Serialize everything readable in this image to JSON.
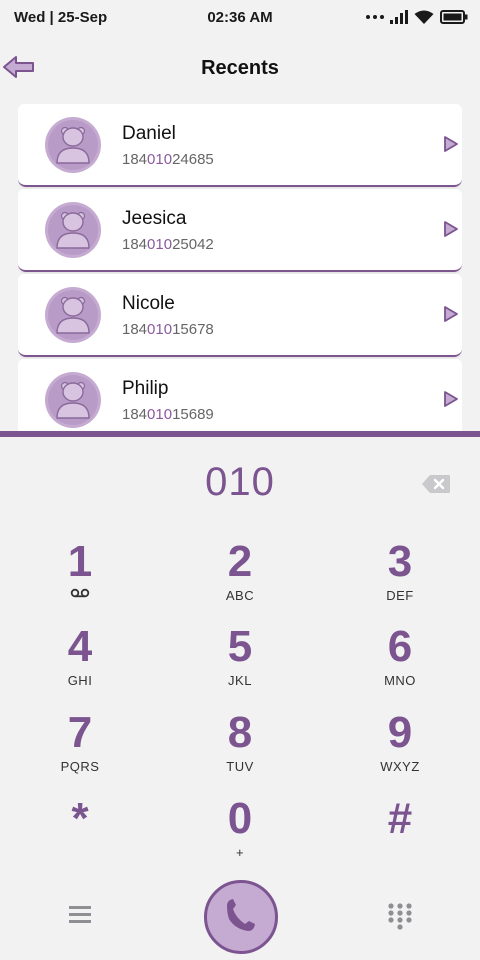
{
  "status_bar": {
    "date": "Wed | 25-Sep",
    "time": "02:36 AM",
    "icons": [
      "dots-icon",
      "signal-icon",
      "wifi-icon",
      "battery-icon"
    ]
  },
  "header": {
    "title": "Recents",
    "back_icon": "back-arrow-icon"
  },
  "recents": [
    {
      "name": "Daniel",
      "number_prefix": "184",
      "number_match": "010",
      "number_suffix": "24685"
    },
    {
      "name": "Jeesica",
      "number_prefix": "184",
      "number_match": "010",
      "number_suffix": "25042"
    },
    {
      "name": "Nicole",
      "number_prefix": "184",
      "number_match": "010",
      "number_suffix": "15678"
    },
    {
      "name": "Philip",
      "number_prefix": "184",
      "number_match": "010",
      "number_suffix": "15689"
    }
  ],
  "dialer": {
    "entered_number": "010",
    "backspace_icon": "backspace-icon"
  },
  "keypad": [
    {
      "digit": "1",
      "letters": "",
      "sub_icon": "voicemail-icon"
    },
    {
      "digit": "2",
      "letters": "ABC"
    },
    {
      "digit": "3",
      "letters": "DEF"
    },
    {
      "digit": "4",
      "letters": "GHI"
    },
    {
      "digit": "5",
      "letters": "JKL"
    },
    {
      "digit": "6",
      "letters": "MNO"
    },
    {
      "digit": "7",
      "letters": "PQRS"
    },
    {
      "digit": "8",
      "letters": "TUV"
    },
    {
      "digit": "9",
      "letters": "WXYZ"
    },
    {
      "digit": "*",
      "letters": ""
    },
    {
      "digit": "0",
      "letters": "+"
    },
    {
      "digit": "#",
      "letters": ""
    }
  ],
  "bottom_bar": {
    "menu_icon": "menu-icon",
    "call_icon": "phone-icon",
    "dialpad_icon": "dialpad-icon"
  },
  "colors": {
    "accent": "#7b5490",
    "accent_light": "#c5abd1",
    "background": "#f2f2f3"
  }
}
